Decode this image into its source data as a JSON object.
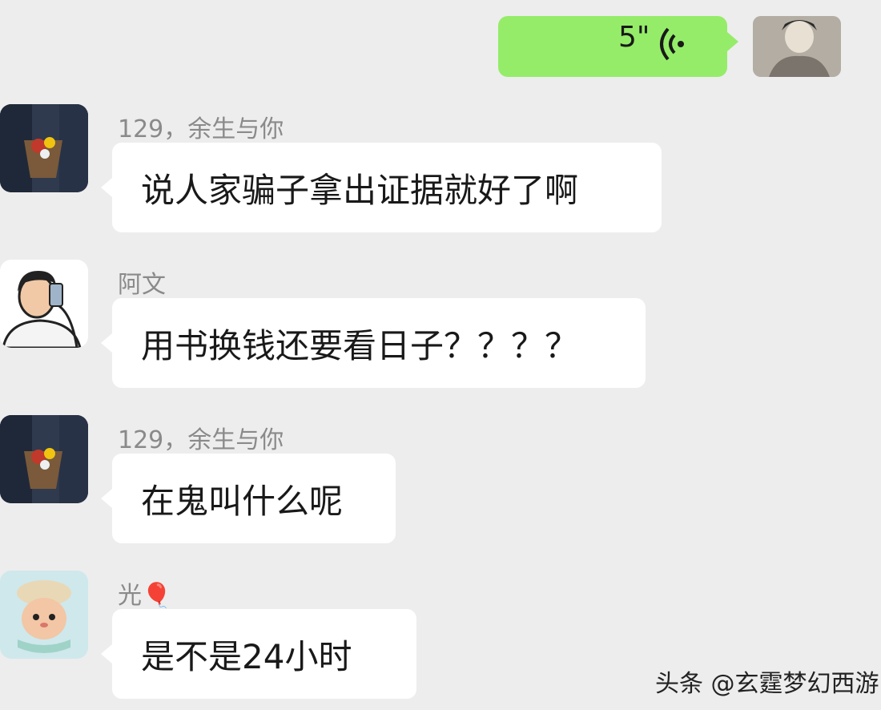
{
  "voice_message": {
    "duration": "5\""
  },
  "messages": [
    {
      "sender": "129，余生与你",
      "text": "说人家骗子拿出证据就好了啊"
    },
    {
      "sender": "阿文",
      "text": "用书换钱还要看日子？？？？"
    },
    {
      "sender": "129，余生与你",
      "text": "在鬼叫什么呢"
    },
    {
      "sender": "光🎈",
      "text": "是不是24小时"
    }
  ],
  "watermark": "头条 @玄霆梦幻西游"
}
